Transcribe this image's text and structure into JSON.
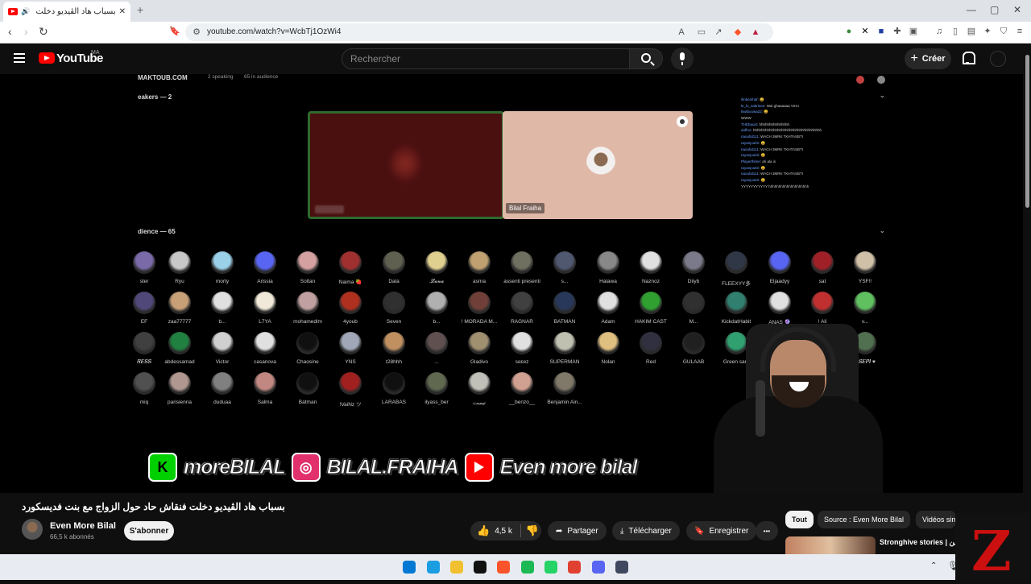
{
  "browser": {
    "tab_title": "بسباب هاد الڤيديو دخلت فنقاش",
    "new_tab": "+",
    "url": "youtube.com/watch?v=WcbTj1OzWi4",
    "window_controls": [
      "—",
      "▢",
      "✕"
    ]
  },
  "youtube": {
    "logo_text": "YouTube",
    "country": "MA",
    "search_placeholder": "Rechercher",
    "create_label": "Créer"
  },
  "video": {
    "room_header": "MAKTOUB.COM",
    "speaking": "2 speaking",
    "in_audience": "65 in audience",
    "speakers_label": "eakers — 2",
    "audience_label": "dience — 65",
    "speaker_name": "Bilal Fraiha",
    "blur_badge": "",
    "chat_lines": [
      {
        "user": "ilmbeinhaf",
        "text": ": 😄"
      },
      {
        "user": "le_lo_sabrinee",
        "text": ": Wai ghaaaaaa VIHo"
      },
      {
        "user": "kiwiboowa22",
        "text": ": 😄"
      },
      {
        "user": "",
        "text": "WWW"
      },
      {
        "user": "THEbaust",
        "text": ": hhhhhhhhhhhhhhh"
      },
      {
        "user": "duffoo",
        "text": ": hhhhhhhhhhhhhhhhhhhhhhhhhhhhhhhhhh"
      },
      {
        "user": "naoufal111",
        "text": ": WACH 3MRK TKHTASBTI"
      },
      {
        "user": "rayanjoubri",
        "text": ": 😄"
      },
      {
        "user": "naoufal111",
        "text": ": WACH 3MRK TKHTASBTI"
      },
      {
        "user": "rayanjoubri",
        "text": ": 😄"
      },
      {
        "user": "Playerthime",
        "text": ": ah ala is"
      },
      {
        "user": "rayanjoubri",
        "text": ": 😄"
      },
      {
        "user": "naoufal111",
        "text": ": WACH 3MRK TKHTASBTI"
      },
      {
        "user": "rayanjoubri",
        "text": ": 😄"
      },
      {
        "user": "",
        "text": "YYYYYYYYYYY hhhhhhhhhhhhhhhhhhhh"
      }
    ],
    "audience_rows": [
      [
        {
          "name": "ster",
          "color": "#7a6aa8"
        },
        {
          "name": "Ryu",
          "color": "#c8c8c8"
        },
        {
          "name": "morty",
          "color": "#9ad0e8"
        },
        {
          "name": "Arissia",
          "color": "#5865f2"
        },
        {
          "name": "Soltan",
          "color": "#d4a0a0"
        },
        {
          "name": "Naima 🍓",
          "color": "#a03030"
        },
        {
          "name": "Dala",
          "color": "#606050"
        },
        {
          "name": ".𝓛𝓪𝓷𝓪",
          "color": "#e0d090"
        },
        {
          "name": "asma",
          "color": "#c0a070"
        },
        {
          "name": "assenti presenti",
          "color": "#707060"
        },
        {
          "name": "s...",
          "color": "#505870"
        },
        {
          "name": "Halawa",
          "color": "#888"
        },
        {
          "name": "Naznoz",
          "color": "#e0e0e0"
        },
        {
          "name": "Diiyb",
          "color": "#7a7a8a"
        },
        {
          "name": "FLEEXYY多",
          "color": "#303848"
        },
        {
          "name": "Eljaadyy",
          "color": "#5865f2"
        },
        {
          "name": "sat",
          "color": "#a02028"
        },
        {
          "name": "YSF!!",
          "color": "#d0c0a8"
        }
      ],
      [
        {
          "name": "EF",
          "color": "#504878"
        },
        {
          "name": "zaa77777",
          "color": "#c8a078"
        },
        {
          "name": "b...",
          "color": "#e0e0e0"
        },
        {
          "name": "L7YA",
          "color": "#f0e8d8"
        },
        {
          "name": "mohamedlm",
          "color": "#c0a0a0"
        },
        {
          "name": "4youb",
          "color": "#b03020"
        },
        {
          "name": "Seven",
          "color": "#303030"
        },
        {
          "name": "b...",
          "color": "#b0b0b0"
        },
        {
          "name": "! MORADA M...",
          "color": "#704038"
        },
        {
          "name": "RAGNAR",
          "color": "#404040"
        },
        {
          "name": "BATMAN",
          "color": "#28385a"
        },
        {
          "name": "Adam",
          "color": "#e0e0e0"
        },
        {
          "name": "HAKIM CAST",
          "color": "#30a030"
        },
        {
          "name": "M...",
          "color": "#303030"
        },
        {
          "name": "KickdatHabit",
          "color": "#308070"
        },
        {
          "name": "ANAS 🔮",
          "color": "#e0e0e0"
        },
        {
          "name": "! Ali",
          "color": "#c03030"
        },
        {
          "name": "v...",
          "color": "#60c060"
        }
      ],
      [
        {
          "name": "𝑹𝑬𝑺𝑺",
          "color": "#404040"
        },
        {
          "name": "abdessamad",
          "color": "#208040"
        },
        {
          "name": "Victor",
          "color": "#d0d0d0"
        },
        {
          "name": "casanova",
          "color": "#e0e0e0"
        },
        {
          "name": "Chaosine",
          "color": "#101010"
        },
        {
          "name": "YNS",
          "color": "#a0a8b8"
        },
        {
          "name": "t28hhh",
          "color": "#c09060"
        },
        {
          "name": "...",
          "color": "#605050"
        },
        {
          "name": "Gladivo",
          "color": "#a09070"
        },
        {
          "name": "ѕαεez",
          "color": "#e0e0e0"
        },
        {
          "name": "SUPERMAN",
          "color": "#c0c0b0"
        },
        {
          "name": "Nolan",
          "color": "#e0c080"
        },
        {
          "name": "Red",
          "color": "#303040"
        },
        {
          "name": "GULAAB",
          "color": "#202020"
        },
        {
          "name": "Green sam",
          "color": "#30a070"
        },
        {
          "name": "",
          "color": "#000"
        },
        {
          "name": "",
          "color": "#000"
        },
        {
          "name": "𝑼𝑺𝑬𝑷𝑰 ♥",
          "color": "#507050"
        }
      ],
      [
        {
          "name": "miq",
          "color": "#505050"
        },
        {
          "name": "parisienna",
          "color": "#b09890"
        },
        {
          "name": "duduaa",
          "color": "#808080"
        },
        {
          "name": "Salma",
          "color": "#c08880"
        },
        {
          "name": "Batman",
          "color": "#101010"
        },
        {
          "name": "!VaiNz ツ",
          "color": "#a02020"
        },
        {
          "name": "LARABAS",
          "color": "#101010"
        },
        {
          "name": "ilyass_ber",
          "color": "#606850"
        },
        {
          "name": "تيست",
          "color": "#c0c0b8"
        },
        {
          "name": "__benzo__",
          "color": "#d0a090"
        },
        {
          "name": "Benjamin Ain...",
          "color": "#807868"
        }
      ]
    ],
    "banner": {
      "kick_letter": "K",
      "kick_handle": "moreBILAL",
      "instagram_handle": "BILAL.FRAIHA",
      "youtube_handle": "Even more bilal"
    }
  },
  "details": {
    "title": "بسباب هاد الڤيديو دخلت فنقاش حاد حول الزواج مع بنت فديسكورد",
    "channel_name": "Even More Bilal",
    "subscribers": "66,5 k abonnés",
    "subscribe_label": "S'abonner",
    "likes": "4,5 k",
    "share_label": "Partager",
    "download_label": "Télécharger",
    "save_label": "Enregistrer",
    "more_label": "•••"
  },
  "sidebar": {
    "chips": [
      "Tout",
      "Source : Even More Bilal",
      "Vidéos sim"
    ],
    "suggestion_title": "Stronghive stories | من"
  },
  "taskbar": {
    "apps": [
      {
        "name": "windows-start",
        "color": "#0078d4"
      },
      {
        "name": "edge",
        "color": "#1b9de2"
      },
      {
        "name": "file-explorer",
        "color": "#f0c030"
      },
      {
        "name": "tiktok",
        "color": "#111111"
      },
      {
        "name": "brave",
        "color": "#fb542b"
      },
      {
        "name": "spotify",
        "color": "#1db954"
      },
      {
        "name": "whatsapp",
        "color": "#25d366"
      },
      {
        "name": "chrome",
        "color": "#e04030"
      },
      {
        "name": "discord",
        "color": "#5865f2"
      },
      {
        "name": "steam",
        "color": "#404860"
      }
    ]
  },
  "colors": {
    "youtube_red": "#ff0000",
    "background": "#0f0f0f",
    "kick_green": "#00d000"
  }
}
